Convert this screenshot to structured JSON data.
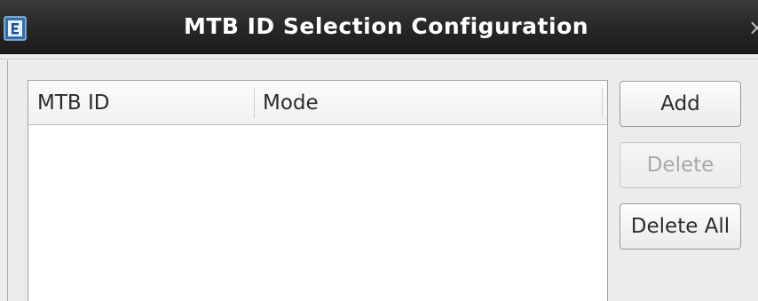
{
  "window": {
    "title": "MTB ID Selection Configuration",
    "close_glyph": "×",
    "app_icon": "app-icon"
  },
  "table": {
    "columns": [
      "MTB ID",
      "Mode"
    ],
    "rows": []
  },
  "buttons": {
    "add": "Add",
    "delete": "Delete",
    "delete_all": "Delete All"
  },
  "states": {
    "delete_enabled": false
  }
}
